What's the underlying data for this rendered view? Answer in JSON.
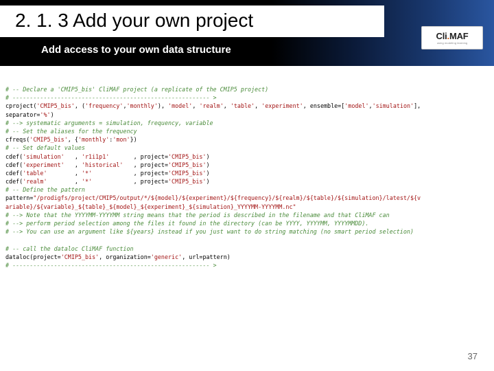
{
  "header": {
    "section_number": "2. 1. 3",
    "title": "Add your own project",
    "subtitle": "Add access to your own data structure"
  },
  "logo": {
    "prefix": "Cli",
    "accent": ".",
    "suffix": "MAF",
    "tagline": "using modeling learning"
  },
  "code": {
    "c01": "# -- Declare a 'CMIP5_bis' CliMAF project (a replicate of the CMIP5 project)",
    "c02": "# --------------------------------------------------------- >",
    "l03a": "cproject(",
    "l03b": "'CMIP5_bis'",
    "l03c": ", (",
    "l03d": "'frequency'",
    "l03e": ",",
    "l03f": "'monthly'",
    "l03g": "), ",
    "l03h": "'model'",
    "l03i": ", ",
    "l03j": "'realm'",
    "l03k": ", ",
    "l03l": "'table'",
    "l03m": ", ",
    "l03n": "'experiment'",
    "l03o": ", ensemble=[",
    "l03p": "'model'",
    "l03q": ",",
    "l03r": "'simulation'",
    "l03s": "],",
    "l04a": "separator=",
    "l04b": "'%'",
    "l04c": ")",
    "c05": "# --> systematic arguments = simulation, frequency, variable",
    "c06": "# -- Set the aliases for the frequency",
    "l07a": "cfreqs(",
    "l07b": "'CMIP5_bis'",
    "l07c": ", {",
    "l07d": "'monthly'",
    "l07e": ":",
    "l07f": "'mon'",
    "l07g": "})",
    "c08": "# -- Set default values",
    "l09a": "cdef(",
    "l09b": "'simulation'",
    "l09c": "   , ",
    "l09d": "'r1i1p1'",
    "l09e": "       , project=",
    "l09f": "'CMIP5_bis'",
    "l09g": ")",
    "l10a": "cdef(",
    "l10b": "'experiment'",
    "l10c": "   , ",
    "l10d": "'historical'",
    "l10e": "   , project=",
    "l10f": "'CMIP5_bis'",
    "l10g": ")",
    "l11a": "cdef(",
    "l11b": "'table'",
    "l11c": "        , ",
    "l11d": "'*'",
    "l11e": "            , project=",
    "l11f": "'CMIP5_bis'",
    "l11g": ")",
    "l12a": "cdef(",
    "l12b": "'realm'",
    "l12c": "        , ",
    "l12d": "'*'",
    "l12e": "            , project=",
    "l12f": "'CMIP5_bis'",
    "l12g": ")",
    "c13": "# -- Define the pattern",
    "l14a": "pattern=",
    "l14b": "\"/prodigfs/project/CMIP5/output/*/${model}/${experiment}/${frequency}/${realm}/${table}/${simulation}/latest/${v",
    "l15": "ariable}/${variable}_${table}_${model}_${experiment}_${simulation}_YYYYMM-YYYYMM.nc\"",
    "c16": "# --> Note that the YYYYMM-YYYYMM string means that the period is described in the filename and that CliMAF can",
    "c17": "# --> perform period selection among the files it found in the directory (can be YYYY, YYYYMM, YYYYMMDD).",
    "c18": "# --> You can use an argument like ${years} instead if you just want to do string matching (no smart period selection)",
    "blank19": "",
    "c20": "# -- call the dataloc CliMAF function",
    "l21a": "dataloc(project=",
    "l21b": "'CMIP5_bis'",
    "l21c": ", organization=",
    "l21d": "'generic'",
    "l21e": ", url=pattern)",
    "c22": "# --------------------------------------------------------- >"
  },
  "page_number": "37"
}
